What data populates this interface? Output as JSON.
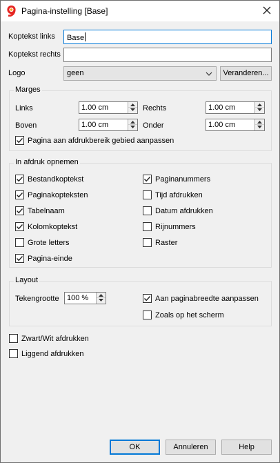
{
  "window": {
    "title": "Pagina-instelling [Base]",
    "app_icon": "banana-9-icon",
    "close_icon": "close-icon"
  },
  "header_fields": {
    "left_label": "Koptekst links",
    "left_value": "Base",
    "right_label": "Koptekst rechts",
    "right_value": "",
    "logo_label": "Logo",
    "logo_value": "geen",
    "change_button": "Veranderen..."
  },
  "margins": {
    "title": "Marges",
    "left_label": "Links",
    "left_value": "1.00 cm",
    "right_label": "Rechts",
    "right_value": "1.00 cm",
    "top_label": "Boven",
    "top_value": "1.00 cm",
    "bottom_label": "Onder",
    "bottom_value": "1.00 cm",
    "fit_label": "Pagina aan afdrukbereik gebied aanpassen",
    "fit_checked": true
  },
  "include": {
    "title": "In afdruk opnemen",
    "left": [
      {
        "label": "Bestandkoptekst",
        "checked": true
      },
      {
        "label": "Paginakopteksten",
        "checked": true
      },
      {
        "label": "Tabelnaam",
        "checked": true
      },
      {
        "label": "Kolomkoptekst",
        "checked": true
      },
      {
        "label": "Grote letters",
        "checked": false
      },
      {
        "label": "Pagina-einde",
        "checked": true
      }
    ],
    "right": [
      {
        "label": "Paginanummers",
        "checked": true
      },
      {
        "label": "Tijd afdrukken",
        "checked": false
      },
      {
        "label": "Datum afdrukken",
        "checked": false
      },
      {
        "label": "Rijnummers",
        "checked": false
      },
      {
        "label": "Raster",
        "checked": false
      }
    ]
  },
  "layout": {
    "title": "Layout",
    "font_size_label": "Tekengrootte",
    "font_size_value": "100 %",
    "fit_width_label": "Aan paginabreedte aanpassen",
    "fit_width_checked": true,
    "as_screen_label": "Zoals op het scherm",
    "as_screen_checked": false
  },
  "options": {
    "bw_label": "Zwart/Wit afdrukken",
    "bw_checked": false,
    "landscape_label": "Liggend afdrukken",
    "landscape_checked": false
  },
  "buttons": {
    "ok": "OK",
    "cancel": "Annuleren",
    "help": "Help"
  },
  "colors": {
    "focus": "#0078d7",
    "dialog_bg": "#f0f0f0",
    "logo_red": "#e52521",
    "logo_orange": "#f7a21b"
  }
}
